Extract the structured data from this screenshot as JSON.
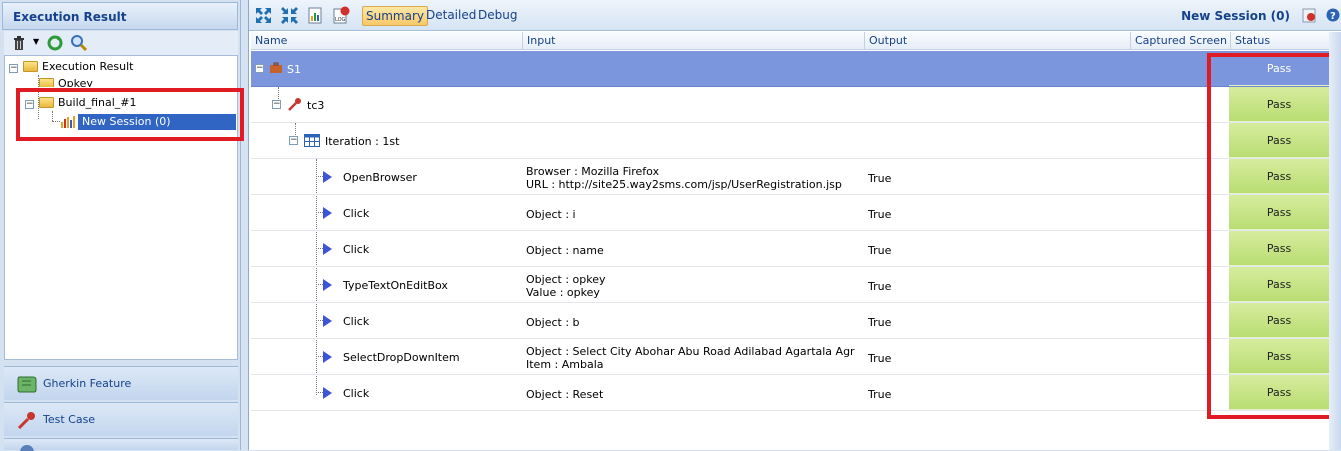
{
  "left_panel": {
    "title": "Execution Result",
    "tree": {
      "root": "Execution Result",
      "child1": "Opkey",
      "child2": "Build_final_#1",
      "selected": "New Session (0)"
    },
    "accordion": [
      "Gherkin Feature",
      "Test Case"
    ]
  },
  "toolbar": {
    "tabs": [
      "Summary",
      "Detailed",
      "Debug"
    ],
    "active_tab": "Summary",
    "session_title": "New Session (0)"
  },
  "grid": {
    "columns": [
      "Name",
      "Input",
      "Output",
      "Captured Screen",
      "Status"
    ],
    "suite": {
      "name": "S1",
      "status": "Pass"
    },
    "testcase": {
      "name": "tc3",
      "status": "Pass"
    },
    "iteration": {
      "name": "Iteration : 1st",
      "status": "Pass"
    },
    "steps": [
      {
        "name": "OpenBrowser",
        "input1": "Browser : Mozilla Firefox",
        "input2": "URL : http://site25.way2sms.com/jsp/UserRegistration.jsp",
        "output": "True",
        "status": "Pass"
      },
      {
        "name": "Click",
        "input1": "Object : i",
        "input2": "",
        "output": "True",
        "status": "Pass"
      },
      {
        "name": "Click",
        "input1": "Object : name",
        "input2": "",
        "output": "True",
        "status": "Pass"
      },
      {
        "name": "TypeTextOnEditBox",
        "input1": "Object : opkey",
        "input2": "Value : opkey",
        "output": "True",
        "status": "Pass"
      },
      {
        "name": "Click",
        "input1": "Object : b",
        "input2": "",
        "output": "True",
        "status": "Pass"
      },
      {
        "name": "SelectDropDownItem",
        "input1": "Object : Select City Abohar Abu Road Adilabad Agartala Agr",
        "input2": "Item : Ambala",
        "output": "True",
        "status": "Pass"
      },
      {
        "name": "Click",
        "input1": "Object : Reset",
        "input2": "",
        "output": "True",
        "status": "Pass"
      }
    ]
  },
  "colors": {
    "suite_row": "#7b96dd",
    "pass_cell": "#c6e485",
    "highlight": "#e01b24",
    "header_text": "#15428b"
  }
}
